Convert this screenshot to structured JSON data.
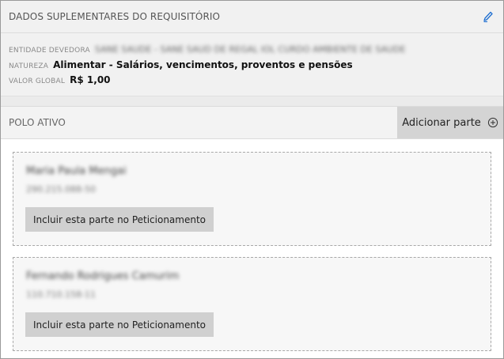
{
  "summary": {
    "title": "DADOS SUPLEMENTARES DO REQUISITÓRIO",
    "edit_icon": "pencil-icon",
    "entidade_label": "ENTIDADE DEVEDORA",
    "entidade_value": "SANE SAUDE - SANE SAUD DE REGAL IOL CURDO AMBIENTE DE SAUDE",
    "natureza_label": "NATUREZA",
    "natureza_value": "Alimentar - Salários, vencimentos, proventos e pensões",
    "valor_label": "VALOR GLOBAL",
    "valor_value": "R$ 1,00"
  },
  "polo": {
    "title": "POLO ATIVO",
    "add_label": "Adicionar parte",
    "add_icon": "plus-circle-icon"
  },
  "parties": [
    {
      "name": "Maria Paula Mengai",
      "doc": "290.215.088-50",
      "button_label": "Incluir esta parte no Peticionamento"
    },
    {
      "name": "Fernando Rodrigues Camurim",
      "doc": "110.710.158-11",
      "button_label": "Incluir esta parte no Peticionamento"
    }
  ],
  "colors": {
    "accent": "#1f6fd1",
    "button_bg": "#d0d0d0",
    "panel_bg": "#f1f1f1"
  }
}
